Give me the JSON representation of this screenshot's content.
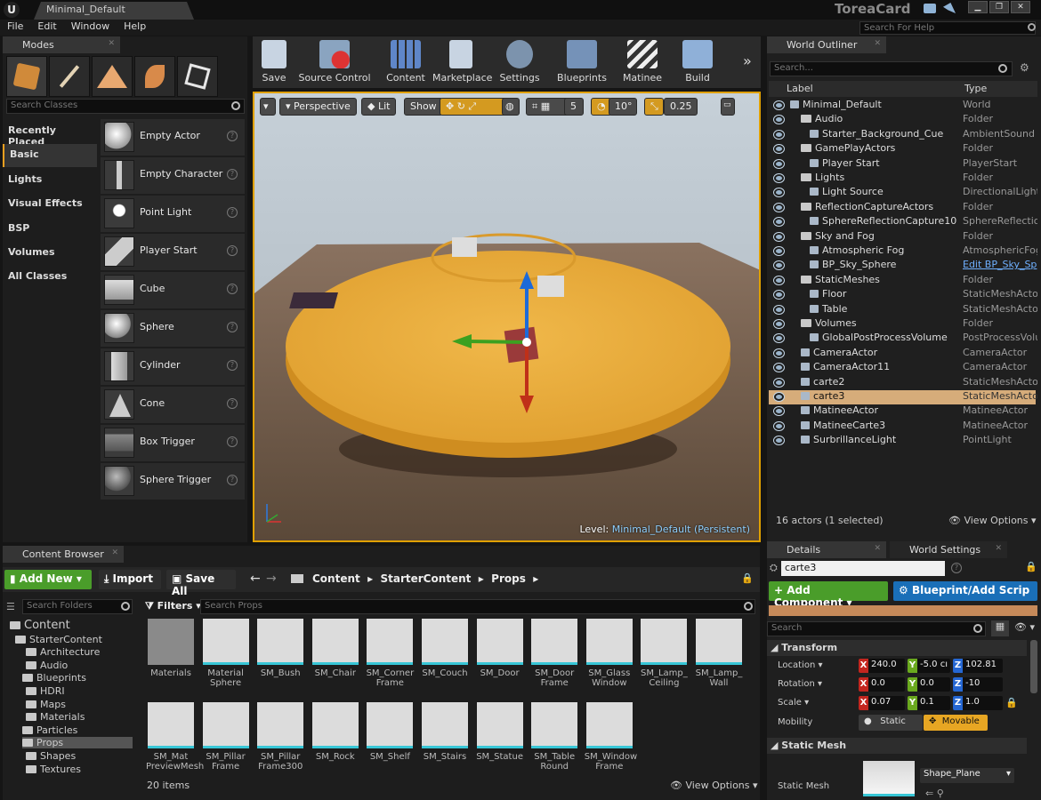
{
  "app": {
    "tab_title": "Minimal_Default",
    "project_name": "ToreaCard",
    "help_search_placeholder": "Search For Help"
  },
  "menu": [
    "File",
    "Edit",
    "Window",
    "Help"
  ],
  "modes": {
    "tab_label": "Modes",
    "search_placeholder": "Search Classes",
    "categories": [
      "Recently Placed",
      "Basic",
      "Lights",
      "Visual Effects",
      "BSP",
      "Volumes",
      "All Classes"
    ],
    "selected_category": "Basic",
    "items": [
      "Empty Actor",
      "Empty Character",
      "Point Light",
      "Player Start",
      "Cube",
      "Sphere",
      "Cylinder",
      "Cone",
      "Box Trigger",
      "Sphere Trigger"
    ]
  },
  "toolbar": [
    "Save",
    "Source Control",
    "Content",
    "Marketplace",
    "Settings",
    "Blueprints",
    "Matinee",
    "Build"
  ],
  "viewport": {
    "perspective": "Perspective",
    "lit": "Lit",
    "show": "Show",
    "grid_snap": "5",
    "rot_snap": "10°",
    "scale_snap": "0.25",
    "level_prefix": "Level:",
    "level_name": "Minimal_Default (Persistent)"
  },
  "outliner": {
    "tab_label": "World Outliner",
    "search_placeholder": "Search...",
    "col_label": "Label",
    "col_type": "Type",
    "rows": [
      {
        "name": "Minimal_Default",
        "type": "World"
      },
      {
        "name": "Audio",
        "type": "Folder"
      },
      {
        "name": "Starter_Background_Cue",
        "type": "AmbientSound"
      },
      {
        "name": "GamePlayActors",
        "type": "Folder"
      },
      {
        "name": "Player Start",
        "type": "PlayerStart"
      },
      {
        "name": "Lights",
        "type": "Folder"
      },
      {
        "name": "Light Source",
        "type": "DirectionalLight"
      },
      {
        "name": "ReflectionCaptureActors",
        "type": "Folder"
      },
      {
        "name": "SphereReflectionCapture10",
        "type": "SphereReflectior"
      },
      {
        "name": "Sky and Fog",
        "type": "Folder"
      },
      {
        "name": "Atmospheric Fog",
        "type": "AtmosphericFog"
      },
      {
        "name": "BP_Sky_Sphere",
        "type": "Edit BP_Sky_Sp"
      },
      {
        "name": "StaticMeshes",
        "type": "Folder"
      },
      {
        "name": "Floor",
        "type": "StaticMeshActor"
      },
      {
        "name": "Table",
        "type": "StaticMeshActor"
      },
      {
        "name": "Volumes",
        "type": "Folder"
      },
      {
        "name": "GlobalPostProcessVolume",
        "type": "PostProcessVolu"
      },
      {
        "name": "CameraActor",
        "type": "CameraActor"
      },
      {
        "name": "CameraActor11",
        "type": "CameraActor"
      },
      {
        "name": "carte2",
        "type": "StaticMeshActor"
      },
      {
        "name": "carte3",
        "type": "StaticMeshActor"
      },
      {
        "name": "MatineeActor",
        "type": "MatineeActor"
      },
      {
        "name": "MatineeCarte3",
        "type": "MatineeActor"
      },
      {
        "name": "SurbrillanceLight",
        "type": "PointLight"
      }
    ],
    "selected_row": "carte3",
    "actor_count": "16 actors (1 selected)",
    "view_options": "View Options"
  },
  "content_browser": {
    "tab_label": "Content Browser",
    "add_new": "Add New",
    "import": "Import",
    "save_all": "Save All",
    "breadcrumb": [
      "Content",
      "StarterContent",
      "Props"
    ],
    "search_folders_placeholder": "Search Folders",
    "filters": "Filters",
    "search_props_placeholder": "Search Props",
    "folders": [
      "Content",
      "StarterContent",
      "Architecture",
      "Audio",
      "Blueprints",
      "HDRI",
      "Maps",
      "Materials",
      "Particles",
      "Props",
      "Shapes",
      "Textures"
    ],
    "assets_row1": [
      "Materials",
      "Material Sphere",
      "SM_Bush",
      "SM_Chair",
      "SM_Corner Frame",
      "SM_Couch",
      "SM_Door",
      "SM_Door Frame",
      "SM_Glass Window",
      "SM_Lamp_ Ceiling",
      "SM_Lamp_ Wall"
    ],
    "assets_row2": [
      "SM_Mat PreviewMesh",
      "SM_Pillar Frame",
      "SM_Pillar Frame300",
      "SM_Rock",
      "SM_Shelf",
      "SM_Stairs",
      "SM_Statue",
      "SM_Table Round",
      "SM_Window Frame"
    ],
    "item_count": "20 items",
    "view_options": "View Options"
  },
  "details": {
    "tab_label": "Details",
    "world_settings_tab": "World Settings",
    "actor_name": "carte3",
    "add_component": "+ Add Component",
    "blueprint_script": "Blueprint/Add Scrip",
    "search_placeholder": "Search",
    "transform_header": "Transform",
    "location_label": "Location",
    "location": [
      "240.0",
      "-5.0 cı",
      "102.81"
    ],
    "rotation_label": "Rotation",
    "rotation": [
      "0.0",
      "0.0",
      "-10"
    ],
    "scale_label": "Scale",
    "scale": [
      "0.07",
      "0.1",
      "1.0"
    ],
    "mobility_label": "Mobility",
    "mobility_static": "Static",
    "mobility_movable": "Movable",
    "static_mesh_header": "Static Mesh",
    "static_mesh_label": "Static Mesh",
    "static_mesh_value": "Shape_Plane"
  },
  "colors": {
    "accent": "#e0a000",
    "selection": "#d6ac7a",
    "add_new_green": "#4a9d2a",
    "blueprint_blue": "#1a6fb8"
  }
}
